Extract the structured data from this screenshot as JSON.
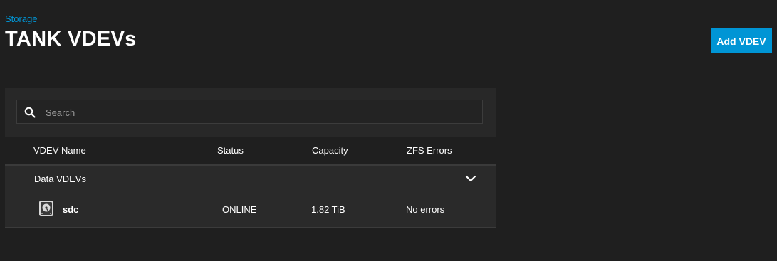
{
  "breadcrumb": "Storage",
  "page_title": "TANK VDEVs",
  "actions": {
    "add_vdev_label": "Add VDEV"
  },
  "search": {
    "placeholder": "Search",
    "value": ""
  },
  "table": {
    "columns": [
      "VDEV Name",
      "Status",
      "Capacity",
      "ZFS Errors"
    ],
    "groups": [
      {
        "label": "Data VDEVs",
        "expanded": true,
        "rows": [
          {
            "name": "sdc",
            "status": "ONLINE",
            "capacity": "1.82 TiB",
            "errors": "No errors",
            "icon": "hard-disk-icon"
          }
        ]
      }
    ]
  },
  "colors": {
    "background": "#1f1f1f",
    "accent": "#0095d5",
    "panel": "#2a2a2a"
  },
  "icons": {
    "search": "search-icon",
    "group_toggle": "chevron-down-icon",
    "disk": "hard-disk-icon"
  }
}
